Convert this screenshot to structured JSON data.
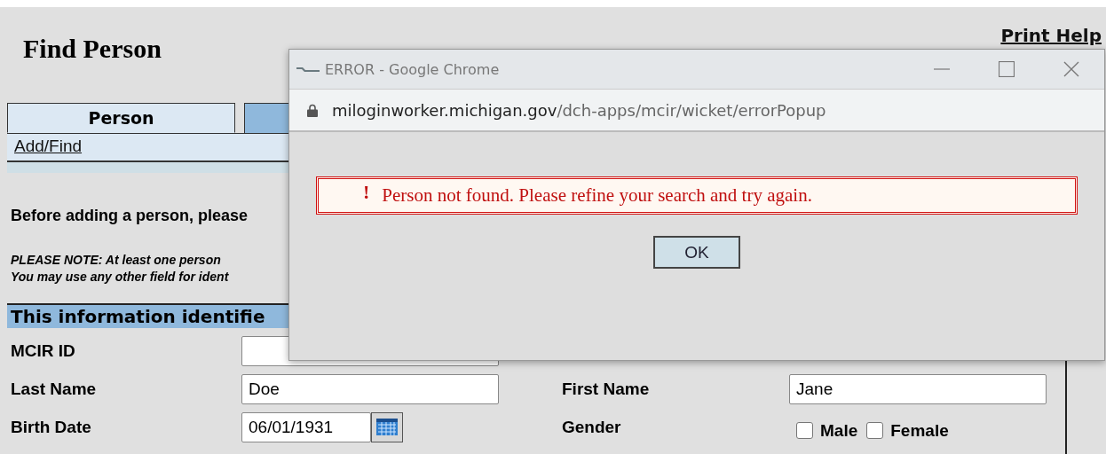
{
  "page": {
    "title": "Find Person",
    "help_link": "Print Help"
  },
  "tabs": [
    {
      "label": "Person",
      "selected": true
    },
    {
      "selected": false
    }
  ],
  "subtabs": [
    {
      "label": "Add/Find"
    }
  ],
  "intro": "Before adding a person, please",
  "note_lines": [
    "PLEASE NOTE:  At least one person",
    "You may use any other field for ident"
  ],
  "section": {
    "title": "This information identifie"
  },
  "form": {
    "mcir_id": {
      "label": "MCIR ID"
    },
    "last_name": {
      "label": "Last Name",
      "value": "Doe"
    },
    "first_name": {
      "label": "First Name",
      "value": "Jane"
    },
    "birth_date": {
      "label": "Birth Date",
      "value": "06/01/1931"
    },
    "gender": {
      "label": "Gender",
      "options": [
        {
          "label": "Male",
          "checked": false
        },
        {
          "label": "Female",
          "checked": false
        }
      ]
    }
  },
  "popup": {
    "title": "ERROR - Google Chrome",
    "url_host": "miloginworker.michigan.gov",
    "url_path": "/dch-apps/mcir/wicket/errorPopup",
    "error_mark": "!",
    "message": "Person not found. Please refine your search and try again.",
    "button": "OK"
  }
}
